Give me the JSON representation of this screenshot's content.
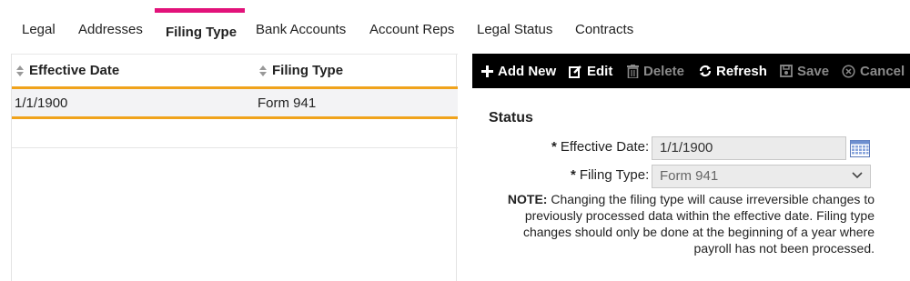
{
  "tabs": [
    {
      "label": "Legal"
    },
    {
      "label": "Addresses"
    },
    {
      "label": "Filing Type"
    },
    {
      "label": "Bank Accounts"
    },
    {
      "label": "Account Reps"
    },
    {
      "label": "Legal Status"
    },
    {
      "label": "Contracts"
    }
  ],
  "active_tab": "Filing Type",
  "grid": {
    "columns": [
      "Effective Date",
      "Filing Type"
    ],
    "rows": [
      {
        "effective_date": "1/1/1900",
        "filing_type": "Form 941"
      }
    ]
  },
  "toolbar": {
    "add_new": "Add New",
    "edit": "Edit",
    "delete": "Delete",
    "refresh": "Refresh",
    "save": "Save",
    "cancel": "Cancel"
  },
  "status": {
    "title": "Status",
    "effective_date_label": "Effective Date:",
    "effective_date_value": "1/1/1900",
    "filing_type_label": "Filing Type:",
    "filing_type_value": "Form 941",
    "required_mark": "*",
    "note_label": "NOTE:",
    "note_text": " Changing the filing type will cause irreversible changes to previously processed data within the effective date. Filing type changes should only be done at the beginning of a year where payroll has not been processed."
  },
  "colors": {
    "accent": "#e2127a",
    "row_highlight": "#f0a31c",
    "toolbar_bg": "#000000"
  }
}
